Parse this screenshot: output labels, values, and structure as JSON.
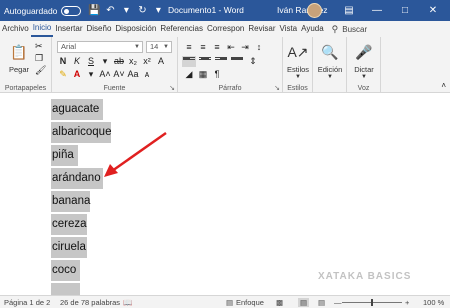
{
  "titlebar": {
    "autosave_label": "Autoguardado",
    "autosave_state": "off",
    "doc_title": "Documento1 - Word",
    "user_name": "Iván Ramírez",
    "color": "#2b579a"
  },
  "tabs": [
    "Archivo",
    "Inicio",
    "Insertar",
    "Diseño",
    "Disposición",
    "Referencias",
    "Correspon",
    "Revisar",
    "Vista",
    "Ayuda"
  ],
  "active_tab": "Inicio",
  "search_label": "Buscar",
  "ribbon": {
    "clipboard": {
      "paste_label": "Pegar",
      "group_label": "Portapapeles"
    },
    "font": {
      "family": "Arial",
      "size": "14",
      "group_label": "Fuente"
    },
    "paragraph": {
      "group_label": "Párrafo"
    },
    "styles": {
      "label": "Estilos",
      "group_label": "Estilos"
    },
    "editing": {
      "label": "Edición"
    },
    "voice": {
      "dictate_label": "Dictar",
      "group_label": "Voz"
    }
  },
  "document": {
    "lines": [
      "aguacate",
      "albaricoque",
      "piña",
      "arándano",
      "banana",
      "cereza",
      "ciruela",
      "coco"
    ],
    "highlight_color": "#c6c6c6",
    "arrow_color": "#e02020"
  },
  "statusbar": {
    "page": "Página 1 de 2",
    "words": "26 de 78 palabras",
    "focus": "Enfoque",
    "zoom": "100 %"
  },
  "watermark": "XATAKA BASICS"
}
